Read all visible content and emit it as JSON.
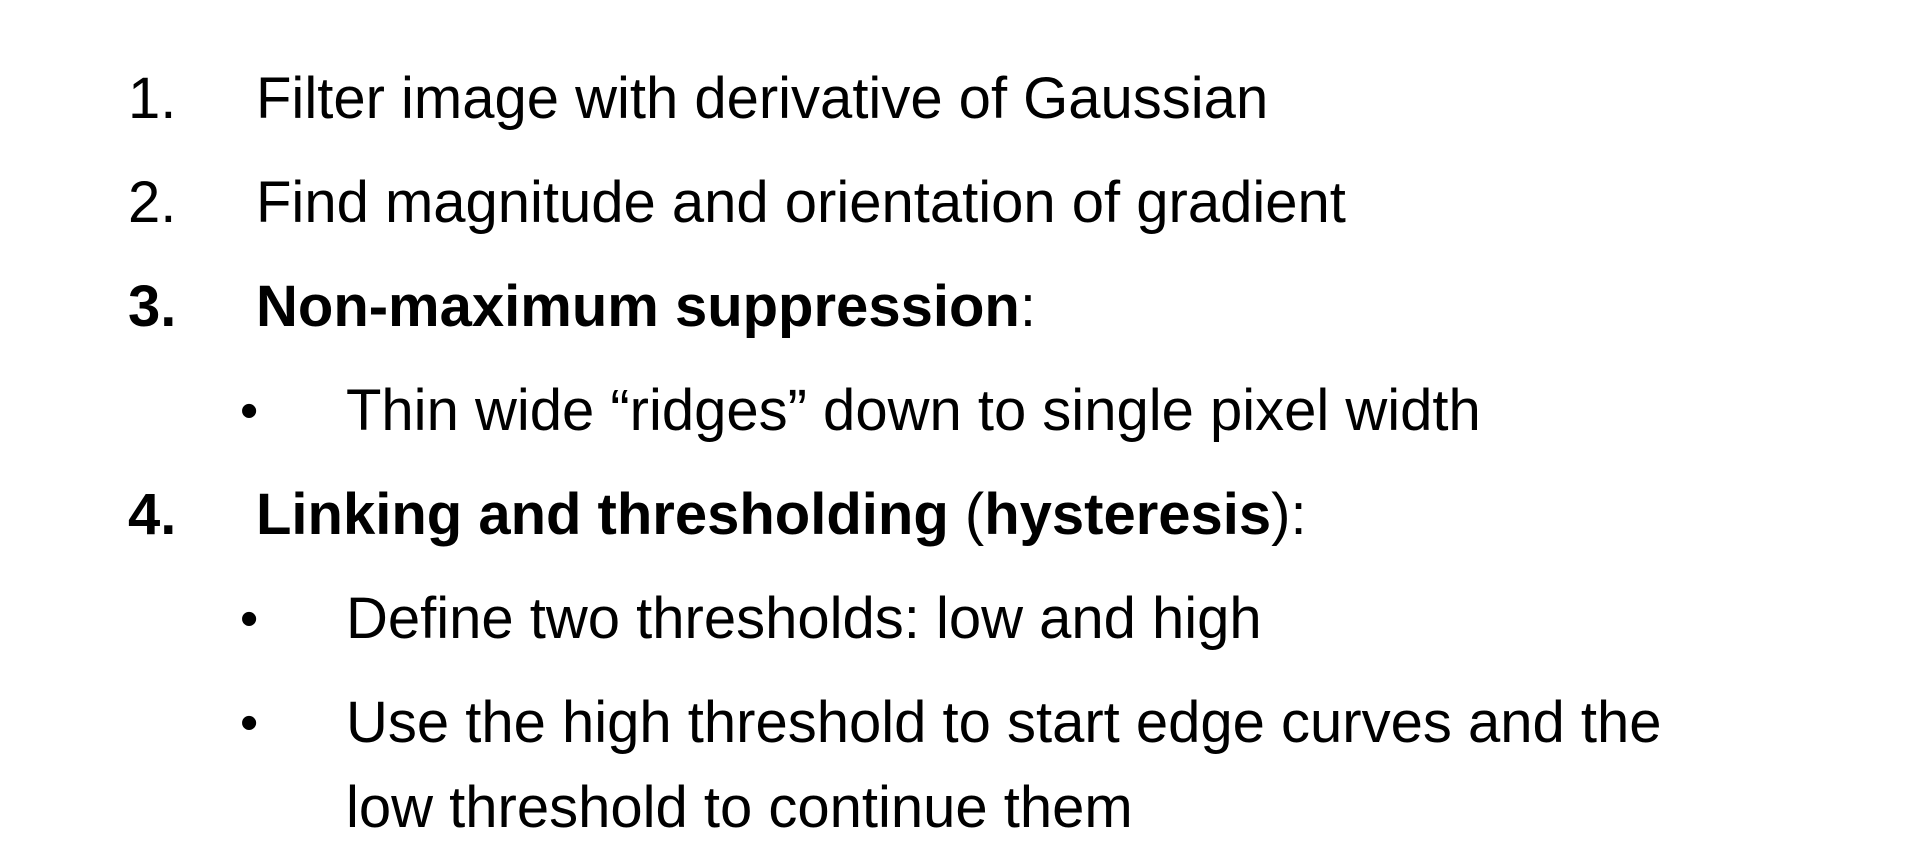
{
  "steps": [
    {
      "number": "1.",
      "text": "Filter image with derivative of Gaussian"
    },
    {
      "number": "2.",
      "text": "Find magnitude and orientation of gradient"
    },
    {
      "number": "3.",
      "title": "Non-maximum suppression",
      "suffix": ":",
      "bullets": [
        "Thin wide “ridges” down to single pixel width"
      ]
    },
    {
      "number": "4.",
      "title": "Linking and thresholding",
      "open_paren": " (",
      "paren_term": "hysteresis",
      "close_paren": "):",
      "bullets": [
        "Define two thresholds: low and high",
        "Use the high threshold to start edge curves and the",
        "low threshold to continue them"
      ]
    }
  ],
  "bullet_symbol": "•"
}
